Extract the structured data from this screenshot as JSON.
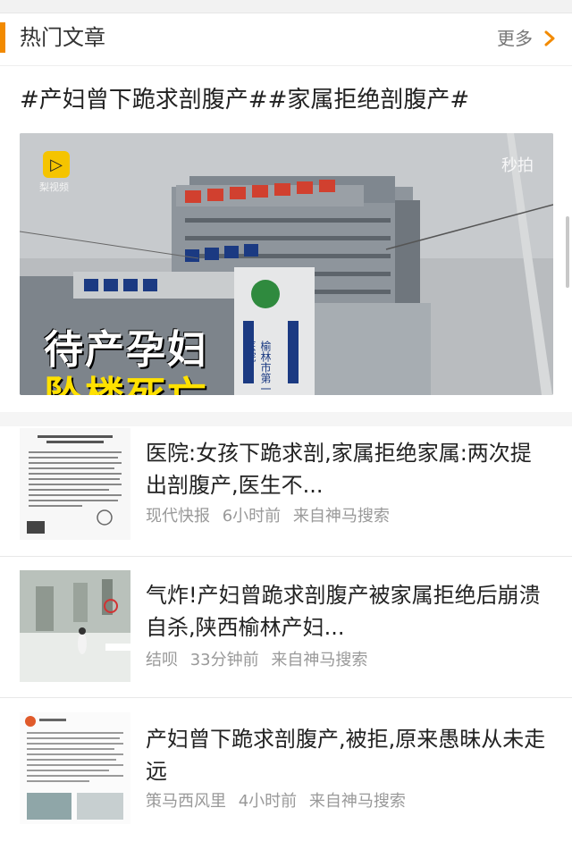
{
  "section": {
    "title": "热门文章",
    "more_label": "更多"
  },
  "topic": "#产妇曾下跪求剖腹产##家属拒绝剖腹产#",
  "hero": {
    "logo_text": "梨视频",
    "watermark": "秒拍",
    "caption_line1": "待产孕妇",
    "caption_line2": "坠楼死亡",
    "building_sign": "榆林市第一医院"
  },
  "articles": [
    {
      "headline": "医院:女孩下跪求剖,家属拒绝家属:两次提出剖腹产,医生不...",
      "source": "现代快报",
      "time": "6小时前",
      "via": "来自神马搜索"
    },
    {
      "headline": "气炸!产妇曾跪求剖腹产被家属拒绝后崩溃自杀,陕西榆林产妇...",
      "source": "结呗",
      "time": "33分钟前",
      "via": "来自神马搜索"
    },
    {
      "headline": "产妇曾下跪求剖腹产,被拒,原来愚昧从未走远",
      "source": "策马西风里",
      "time": "4小时前",
      "via": "来自神马搜索"
    }
  ],
  "colors": {
    "accent": "#f28a00",
    "meta": "#999999"
  }
}
